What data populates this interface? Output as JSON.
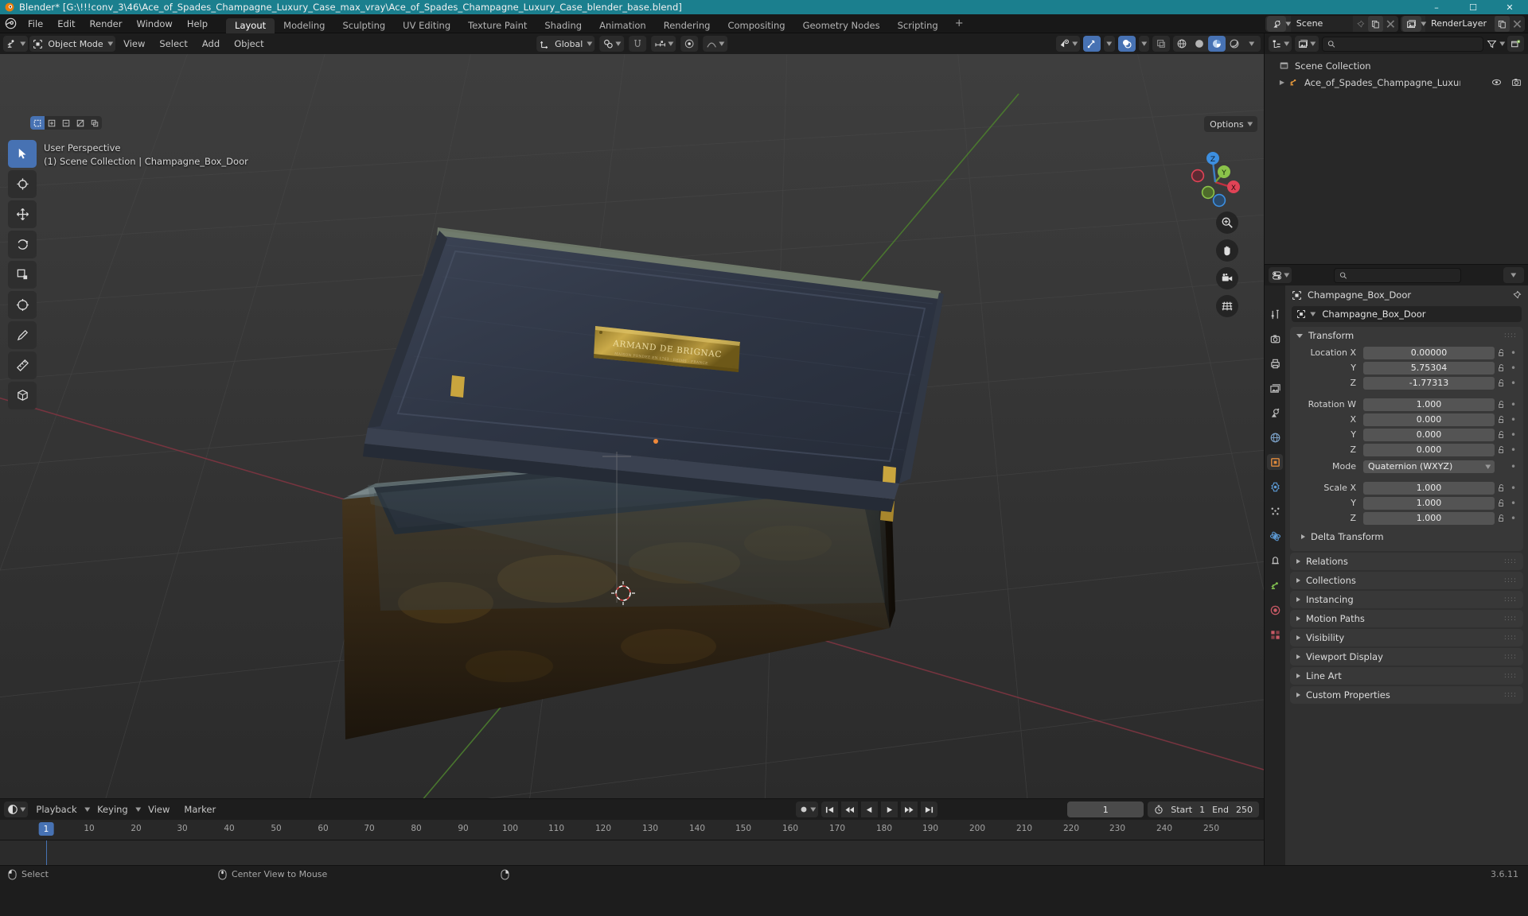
{
  "titlebar": {
    "text": "Blender* [G:\\!!!conv_3\\46\\Ace_of_Spades_Champagne_Luxury_Case_max_vray\\Ace_of_Spades_Champagne_Luxury_Case_blender_base.blend]",
    "minimize": "–",
    "maximize": "☐",
    "close": "✕"
  },
  "topbar": {
    "menus": [
      "File",
      "Edit",
      "Render",
      "Window",
      "Help"
    ],
    "workspaces": [
      "Layout",
      "Modeling",
      "Sculpting",
      "UV Editing",
      "Texture Paint",
      "Shading",
      "Animation",
      "Rendering",
      "Compositing",
      "Geometry Nodes",
      "Scripting"
    ],
    "active_workspace": "Layout",
    "add_workspace": "+",
    "scene_name": "Scene",
    "viewlayer_name": "RenderLayer"
  },
  "viewport_header": {
    "mode": "Object Mode",
    "menus": [
      "View",
      "Select",
      "Add",
      "Object"
    ],
    "transform_orientation": "Global",
    "options_label": "Options"
  },
  "viewport": {
    "perspective_label": "User Perspective",
    "collection_label": "(1) Scene Collection | Champagne_Box_Door",
    "gizmo_axes": [
      "X",
      "Y",
      "Z"
    ],
    "nav_icons": [
      "zoom-icon",
      "hand-icon",
      "camera-icon",
      "grid-icon"
    ],
    "plaque_line1": "ARMAND DE BRIGNAC",
    "plaque_line2": "MAISON FONDEE EN 1763 · REIMS · FRANCE"
  },
  "outliner": {
    "search_placeholder": "",
    "rows": [
      {
        "label": "Scene Collection",
        "icon": "collection-icon",
        "indent": 0,
        "expandable": false
      },
      {
        "label": "Ace_of_Spades_Champagne_Luxury_Cas",
        "icon": "mesh-object-icon",
        "indent": 1,
        "expandable": true
      }
    ]
  },
  "properties": {
    "search_placeholder": "",
    "breadcrumb": "Champagne_Box_Door",
    "object_name": "Champagne_Box_Door",
    "transform": {
      "title": "Transform",
      "location": {
        "label": "Location",
        "axes": [
          "X",
          "Y",
          "Z"
        ],
        "values": [
          "0.00000",
          "5.75304",
          "-1.77313"
        ]
      },
      "rotation": {
        "label": "Rotation",
        "axes": [
          "W",
          "X",
          "Y",
          "Z"
        ],
        "values": [
          "1.000",
          "0.000",
          "0.000",
          "0.000"
        ]
      },
      "mode_label": "Mode",
      "mode_value": "Quaternion (WXYZ)",
      "scale": {
        "label": "Scale",
        "axes": [
          "X",
          "Y",
          "Z"
        ],
        "values": [
          "1.000",
          "1.000",
          "1.000"
        ]
      },
      "delta_transform": "Delta Transform"
    },
    "panels": [
      "Relations",
      "Collections",
      "Instancing",
      "Motion Paths",
      "Visibility",
      "Viewport Display",
      "Line Art",
      "Custom Properties"
    ]
  },
  "timeline": {
    "menus": [
      "Playback",
      "Keying",
      "View",
      "Marker"
    ],
    "current_frame": "1",
    "start_label": "Start",
    "start_value": "1",
    "end_label": "End",
    "end_value": "250",
    "ticks": [
      "10",
      "20",
      "30",
      "40",
      "50",
      "60",
      "70",
      "80",
      "90",
      "100",
      "110",
      "120",
      "130",
      "140",
      "150",
      "160",
      "170",
      "180",
      "190",
      "200",
      "210",
      "220",
      "230",
      "240",
      "250"
    ],
    "playhead_label": "1"
  },
  "statusbar": {
    "items": [
      {
        "icon": "mouse-left-icon",
        "label": "Select"
      },
      {
        "icon": "mouse-middle-icon",
        "label": "Center View to Mouse"
      },
      {
        "icon": "mouse-right-icon",
        "label": ""
      }
    ],
    "version": "3.6.11"
  },
  "colors": {
    "titlebar_bg": "#1b7f8e",
    "accent_blue": "#4772b3",
    "axis_x": "#e04356",
    "axis_y": "#8bc34a",
    "axis_z": "#3d8fe0",
    "panel_bg": "#303030"
  }
}
